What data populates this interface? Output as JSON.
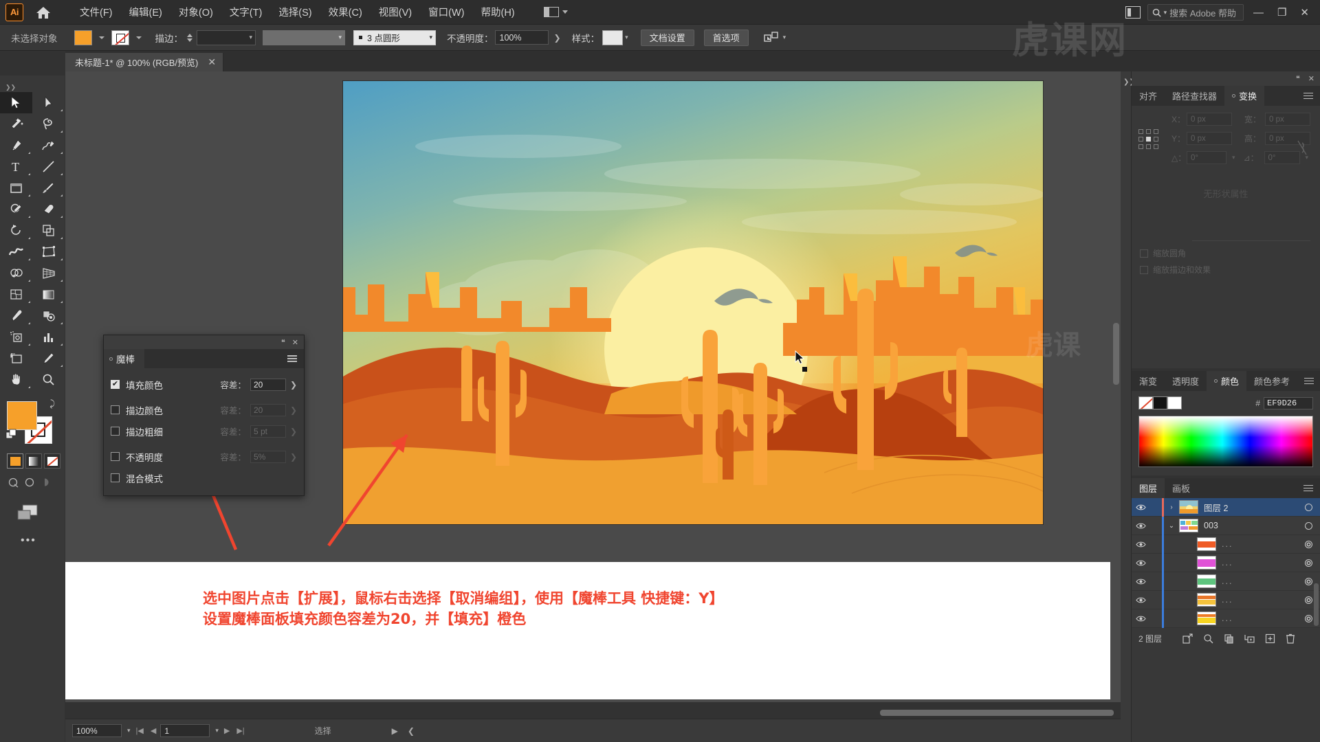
{
  "app": {
    "logo": "Ai",
    "title": "Adobe Illustrator"
  },
  "menu": {
    "items": [
      {
        "label": "文件(F)"
      },
      {
        "label": "编辑(E)"
      },
      {
        "label": "对象(O)"
      },
      {
        "label": "文字(T)"
      },
      {
        "label": "选择(S)"
      },
      {
        "label": "效果(C)"
      },
      {
        "label": "视图(V)"
      },
      {
        "label": "窗口(W)"
      },
      {
        "label": "帮助(H)"
      }
    ],
    "search_placeholder": "搜索 Adobe 帮助",
    "window_buttons": [
      "—",
      "❐",
      "✕"
    ]
  },
  "control_bar": {
    "selection_status": "未选择对象",
    "fill_color": "#F6A02A",
    "stroke_label": "描边：",
    "stroke_weight": "",
    "stroke_profile_label": "",
    "brush_label": "3 点圆形",
    "opacity_label": "不透明度：",
    "opacity_value": "100%",
    "style_label": "样式：",
    "doc_setup_button": "文档设置",
    "preferences_button": "首选项"
  },
  "document_tab": {
    "title": "未标题-1* @ 100% (RGB/预览)",
    "close": "✕"
  },
  "toolbar": {
    "tools": [
      "selection-tool",
      "direct-selection-tool",
      "magic-wand-tool",
      "lasso-tool",
      "pen-tool",
      "curvature-tool",
      "type-tool",
      "line-segment-tool",
      "rectangle-tool",
      "paintbrush-tool",
      "shaper-tool",
      "eraser-tool",
      "rotate-tool",
      "scale-tool",
      "width-tool",
      "free-transform-tool",
      "shape-builder-tool",
      "perspective-grid-tool",
      "mesh-tool",
      "gradient-tool",
      "eyedropper-tool",
      "blend-tool",
      "symbol-sprayer-tool",
      "column-graph-tool",
      "artboard-tool",
      "slice-tool",
      "hand-tool",
      "zoom-tool"
    ],
    "fill_color": "#F6A02A",
    "stroke_color": "none",
    "more_label": "•••"
  },
  "magic_wand_panel": {
    "tab_label": "魔棒",
    "rows": [
      {
        "label": "填充颜色",
        "checked": true,
        "tol_label": "容差：",
        "tol_value": "20",
        "enabled": true
      },
      {
        "label": "描边颜色",
        "checked": false,
        "tol_label": "容差：",
        "tol_value": "20",
        "enabled": false
      },
      {
        "label": "描边粗细",
        "checked": false,
        "tol_label": "容差：",
        "tol_value": "5 pt",
        "enabled": false
      },
      {
        "label": "不透明度",
        "checked": false,
        "tol_label": "容差：",
        "tol_value": "5%",
        "enabled": false
      },
      {
        "label": "混合模式",
        "checked": false,
        "tol_label": "",
        "tol_value": "",
        "enabled": false
      }
    ]
  },
  "transform_panel": {
    "tabs": [
      {
        "label": "对齐",
        "active": false
      },
      {
        "label": "路径查找器",
        "active": false
      },
      {
        "label": "变换",
        "active": true
      }
    ],
    "x_label": "X：",
    "x_value": "0 px",
    "y_label": "Y：",
    "y_value": "0 px",
    "w_label": "宽：",
    "w_value": "0 px",
    "h_label": "高：",
    "h_value": "0 px",
    "angle_label": "△：",
    "angle_value": "0°",
    "shear_label": "⊿：",
    "shear_value": "0°",
    "empty_text": "无形状属性",
    "option_scale_corners": "缩放圆角",
    "option_scale_strokes": "缩放描边和效果"
  },
  "color_panel": {
    "tabs": [
      {
        "label": "渐变",
        "active": false
      },
      {
        "label": "透明度",
        "active": false
      },
      {
        "label": "颜色",
        "active": true
      },
      {
        "label": "颜色参考",
        "active": false
      }
    ],
    "hex_symbol": "#",
    "hex_value": "EF9D26"
  },
  "layers_panel": {
    "tabs": [
      {
        "label": "图层",
        "active": true
      },
      {
        "label": "画板",
        "active": false
      }
    ],
    "rows": [
      {
        "name": "图层 2",
        "selected": true,
        "indent": 0,
        "expander": "›",
        "color": "#e86a5a",
        "thumb": "artwork"
      },
      {
        "name": "003",
        "selected": false,
        "indent": 0,
        "expander": "⌄",
        "color": "#3b7ddd",
        "thumb": "group"
      },
      {
        "name": "...",
        "selected": false,
        "indent": 1,
        "expander": "",
        "color": "#3b7ddd",
        "thumb": "red"
      },
      {
        "name": "...",
        "selected": false,
        "indent": 1,
        "expander": "",
        "color": "#3b7ddd",
        "thumb": "magenta"
      },
      {
        "name": "...",
        "selected": false,
        "indent": 1,
        "expander": "",
        "color": "#3b7ddd",
        "thumb": "green"
      },
      {
        "name": "...",
        "selected": false,
        "indent": 1,
        "expander": "",
        "color": "#3b7ddd",
        "thumb": "orange"
      },
      {
        "name": "...",
        "selected": false,
        "indent": 1,
        "expander": "",
        "color": "#3b7ddd",
        "thumb": "yellow"
      }
    ],
    "footer_count": "2 图层",
    "footer_icons": [
      "release-to-layers-icon",
      "locate-object-icon",
      "make-clipping-mask-icon",
      "create-sublayer-icon",
      "new-layer-icon",
      "delete-layer-icon"
    ]
  },
  "status_bar": {
    "zoom": "100%",
    "page": "1",
    "status_text": "选择",
    "first_icon": "|◀",
    "prev_icon": "◀",
    "next_icon": "▶",
    "last_icon": "▶|"
  },
  "annotation": {
    "line1": "选中图片点击【扩展】，鼠标右击选择【取消编组】，使用【魔棒工具 快捷键：Y】",
    "line2": "设置魔棒面板填充颜色容差为20，并【填充】橙色",
    "color": "#f0452f"
  },
  "artwork": {
    "name": "desert-sunset-illustration",
    "sky_top": "#5aa6c8",
    "sky_mid": "#b8cf9a",
    "sky_warm": "#e8c960",
    "sun": "#faea9a",
    "sand": "#f0a030",
    "mesa_dark": "#cc5418",
    "cactus": "#f9a33a"
  }
}
